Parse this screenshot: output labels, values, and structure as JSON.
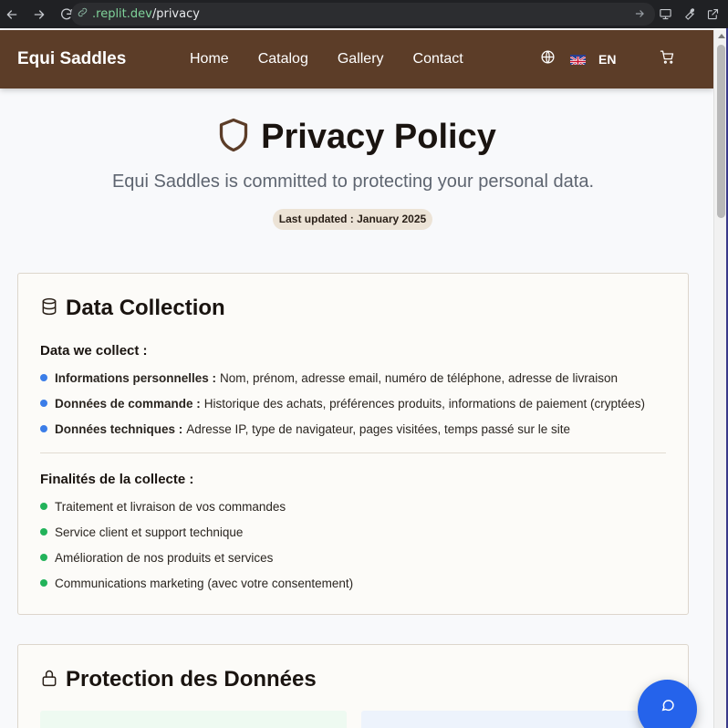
{
  "browser": {
    "url_domain": ".replit.dev",
    "url_path": "/privacy"
  },
  "header": {
    "brand": "Equi Saddles",
    "nav": [
      "Home",
      "Catalog",
      "Gallery",
      "Contact"
    ],
    "language": "EN"
  },
  "hero": {
    "title": "Privacy Policy",
    "subtitle": "Equi Saddles is committed to protecting your personal data.",
    "updated": "Last updated : January 2025"
  },
  "data_collection": {
    "title": "Data Collection",
    "collect_heading": "Data we collect :",
    "collect_items": [
      {
        "label": "Informations personnelles :",
        "text": "Nom, prénom, adresse email, numéro de téléphone, adresse de livraison"
      },
      {
        "label": "Données de commande :",
        "text": "Historique des achats, préférences produits, informations de paiement (cryptées)"
      },
      {
        "label": "Données techniques :",
        "text": "Adresse IP, type de navigateur, pages visitées, temps passé sur le site"
      }
    ],
    "purpose_heading": "Finalités de la collecte :",
    "purpose_items": [
      "Traitement et livraison de vos commandes",
      "Service client et support technique",
      "Amélioration de nos produits et services",
      "Communications marketing (avec votre consentement)"
    ]
  },
  "protection": {
    "title": "Protection des Données"
  },
  "colors": {
    "header_bg": "#5c3d28",
    "blue_bullet": "#3b7de8",
    "green_bullet": "#22b35a",
    "chat_button": "#2563eb"
  }
}
